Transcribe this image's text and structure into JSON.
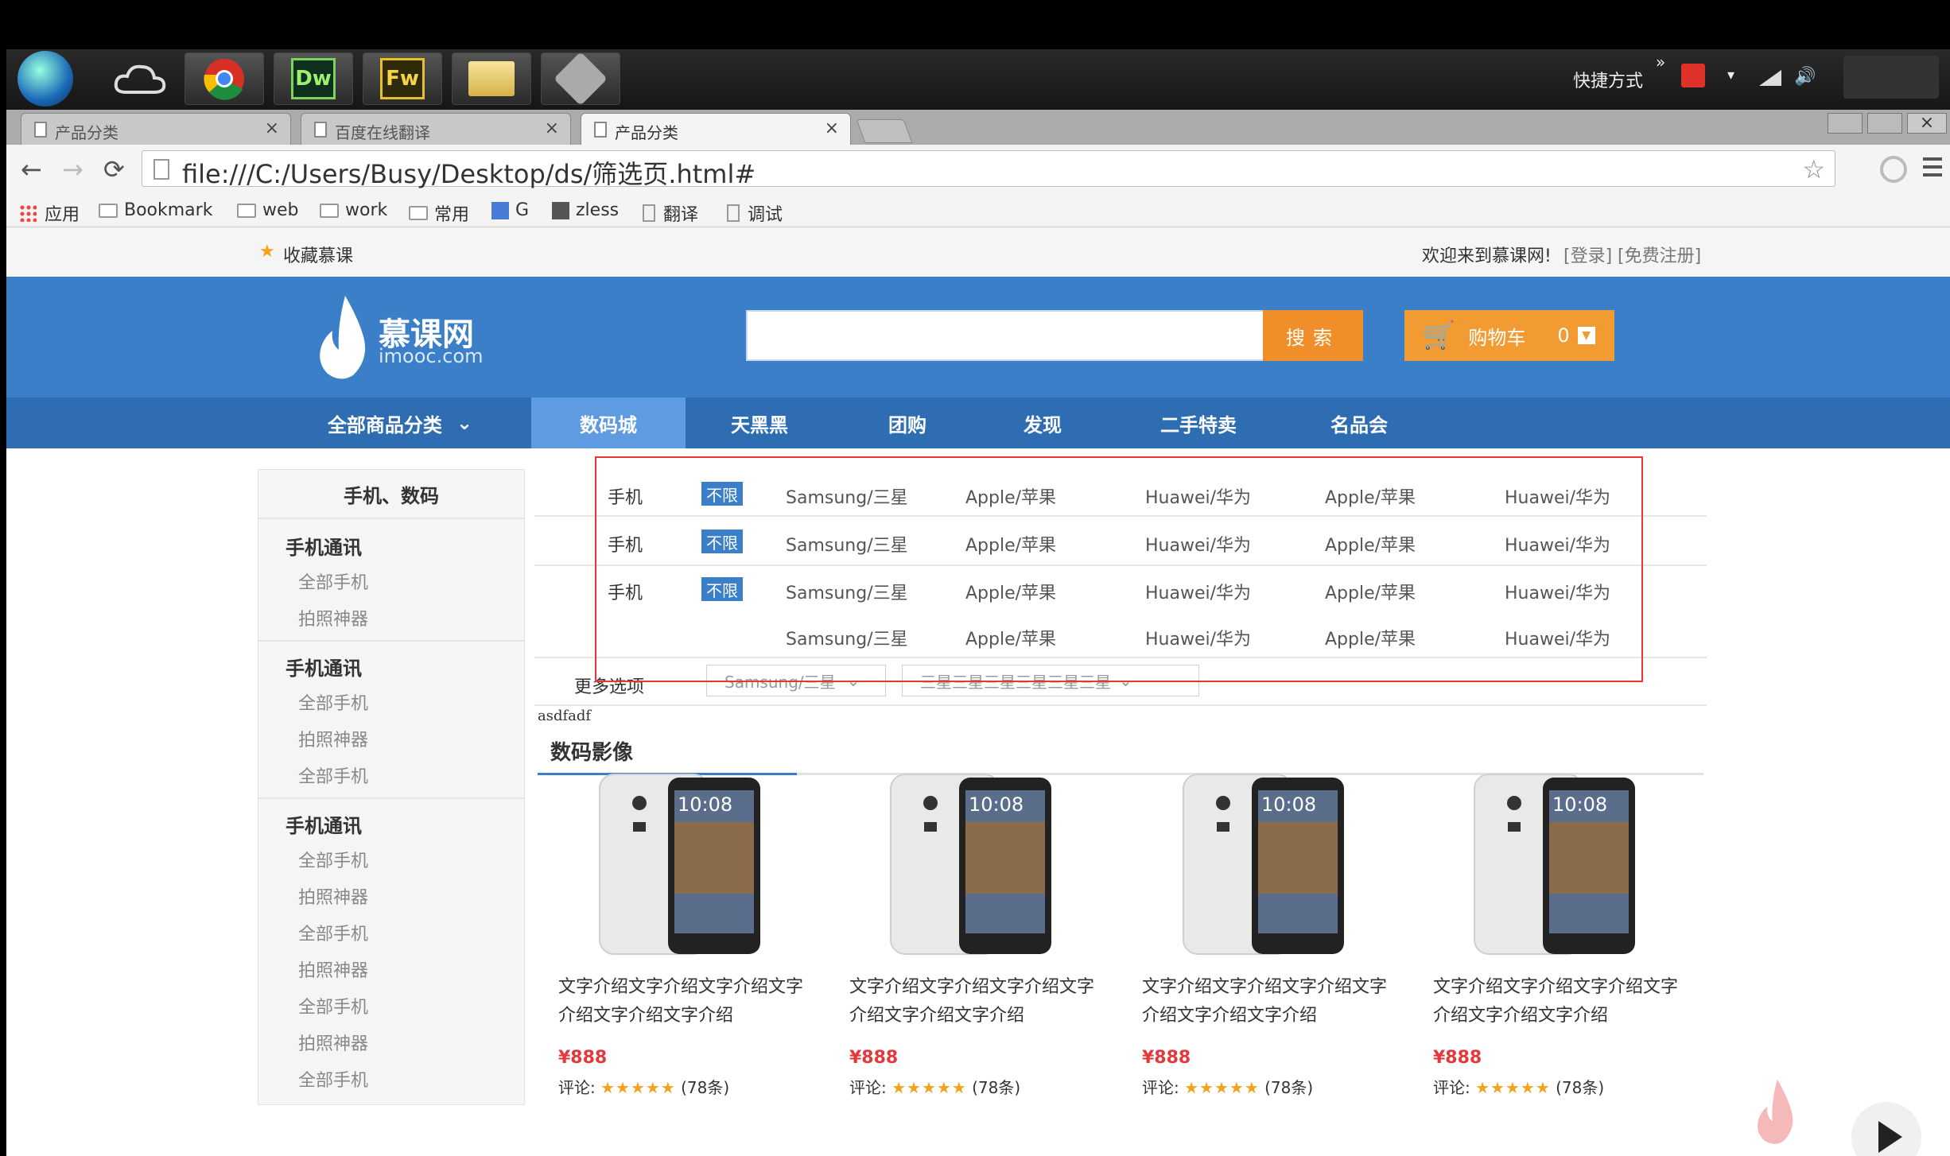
{
  "taskbar": {
    "apps": [
      "Dw",
      "Fw"
    ],
    "shortcut_label": "快捷方式",
    "shortcut_arrow": "»"
  },
  "tabs": [
    {
      "label": "产品分类"
    },
    {
      "label": "百度在线翻译"
    },
    {
      "label": "产品分类"
    }
  ],
  "toolbar": {
    "url": "file:///C:/Users/Busy/Desktop/ds/筛选页.html#"
  },
  "bookmarks": [
    "应用",
    "Bookmark",
    "web",
    "work",
    "常用",
    "G",
    "zless",
    "翻译",
    "调试"
  ],
  "page": {
    "favorite_label": "收藏慕课",
    "welcome": "欢迎来到慕课网!",
    "login": "[登录]",
    "register": "[免费注册]",
    "logo_text": "慕课网",
    "logo_sub": "imooc.com",
    "search_placeholder": "",
    "search_btn": "搜索",
    "cart_label": "购物车",
    "cart_count": "0",
    "all_categories": "全部商品分类",
    "nav": [
      "数码城",
      "天黑黑",
      "团购",
      "发现",
      "二手特卖",
      "名品会"
    ]
  },
  "sidebar": {
    "title": "手机、数码",
    "groups": [
      {
        "head": "手机通讯",
        "items": [
          "全部手机",
          "拍照神器"
        ]
      },
      {
        "head": "手机通讯",
        "items": [
          "全部手机",
          "拍照神器",
          "全部手机"
        ]
      },
      {
        "head": "手机通讯",
        "items": [
          "全部手机",
          "拍照神器",
          "全部手机",
          "拍照神器",
          "全部手机",
          "拍照神器",
          "全部手机"
        ]
      }
    ]
  },
  "filter": {
    "rows": [
      {
        "label": "手机",
        "tag": "不限",
        "options": [
          "Samsung/三星",
          "Apple/苹果",
          "Huawei/华为",
          "Apple/苹果",
          "Huawei/华为"
        ]
      },
      {
        "label": "手机",
        "tag": "不限",
        "options": [
          "Samsung/三星",
          "Apple/苹果",
          "Huawei/华为",
          "Apple/苹果",
          "Huawei/华为"
        ]
      },
      {
        "label": "手机",
        "tag": "不限",
        "options": [
          "Samsung/三星",
          "Apple/苹果",
          "Huawei/华为",
          "Apple/苹果",
          "Huawei/华为"
        ]
      },
      {
        "label": "",
        "tag": "",
        "options": [
          "Samsung/三星",
          "Apple/苹果",
          "Huawei/华为",
          "Apple/苹果",
          "Huawei/华为"
        ]
      }
    ],
    "more_label": "更多选项",
    "dropdown1": "Samsung/三星",
    "dropdown2": "三星三星三星三星三星三星"
  },
  "misc_text": "asdfadf",
  "section_title": "数码影像",
  "products": [
    {
      "screen_time": "10:08",
      "desc": "文字介绍文字介绍文字介绍文字介绍文字介绍文字介绍",
      "price": "¥888",
      "rating_label": "评论:",
      "stars": "★★★★★",
      "count": "(78条)"
    },
    {
      "screen_time": "10:08",
      "desc": "文字介绍文字介绍文字介绍文字介绍文字介绍文字介绍",
      "price": "¥888",
      "rating_label": "评论:",
      "stars": "★★★★★",
      "count": "(78条)"
    },
    {
      "screen_time": "10:08",
      "desc": "文字介绍文字介绍文字介绍文字介绍文字介绍文字介绍",
      "price": "¥888",
      "rating_label": "评论:",
      "stars": "★★★★★",
      "count": "(78条)"
    },
    {
      "screen_time": "10:08",
      "desc": "文字介绍文字介绍文字介绍文字介绍文字介绍文字介绍",
      "price": "¥888",
      "rating_label": "评论:",
      "stars": "★★★★★",
      "count": "(78条)"
    }
  ],
  "colors": {
    "brand_blue": "#3a7fc8",
    "nav_blue": "#2f6db3",
    "nav_active": "#5f9be0",
    "orange": "#f08f2a",
    "price_red": "#e4393c",
    "highlight_red": "#ee3333"
  }
}
